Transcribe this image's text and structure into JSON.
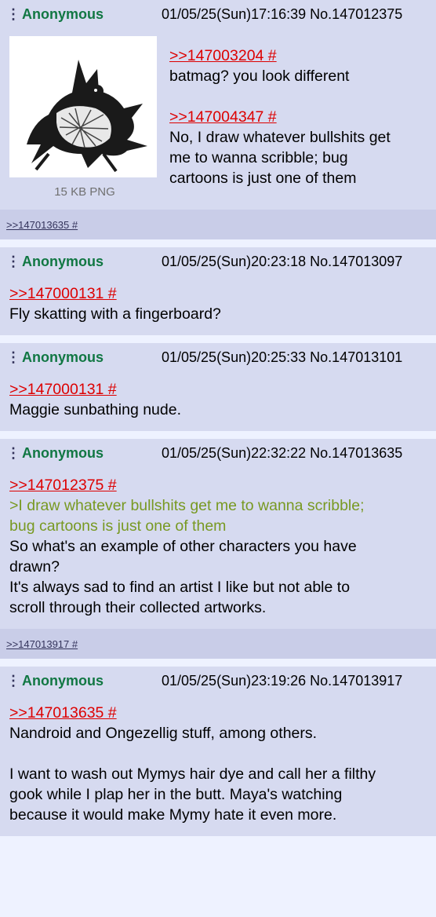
{
  "posts": [
    {
      "name": "Anonymous",
      "date": "01/05/25(Sun)17:16:39",
      "number": "No.147012375",
      "file_info": "15 KB PNG",
      "quote1": ">>147003204 #",
      "line1": "batmag? you look different",
      "quote2": ">>147004347 #",
      "line2a": "No, I draw whatever bullshits get",
      "line2b": "me to wanna scribble; bug",
      "line2c": "cartoons is just one of them",
      "backlink": ">>147013635 #"
    },
    {
      "name": "Anonymous",
      "date": "01/05/25(Sun)20:23:18",
      "number": "No.147013097",
      "quote1": ">>147000131 #",
      "line1": "Fly skatting with a fingerboard?"
    },
    {
      "name": "Anonymous",
      "date": "01/05/25(Sun)20:25:33",
      "number": "No.147013101",
      "quote1": ">>147000131 #",
      "line1": "Maggie sunbathing nude."
    },
    {
      "name": "Anonymous",
      "date": "01/05/25(Sun)22:32:22",
      "number": "No.147013635",
      "quote1": ">>147012375 #",
      "green1": ">I draw whatever bullshits get me to wanna scribble;",
      "green2": "bug cartoons is just one of them",
      "line1": "So what's an example of other characters you have",
      "line2": "drawn?",
      "line3": "It's always sad to find an artist I like but not able to",
      "line4": "scroll through their collected artworks.",
      "backlink": ">>147013917 #"
    },
    {
      "name": "Anonymous",
      "date": "01/05/25(Sun)23:19:26",
      "number": "No.147013917",
      "quote1": ">>147013635 #",
      "line1": "Nandroid and Ongezellig stuff, among others.",
      "line2": "I want to wash out Mymys hair dye and call her a filthy",
      "line3": "gook while I plap her in the butt. Maya's watching",
      "line4": "because it would make Mymy hate it even more."
    }
  ],
  "colors": {
    "name": "#117743",
    "quote": "#dd0000",
    "greentext": "#789922",
    "post_bg": "#d6daf0",
    "page_bg": "#eef2ff"
  },
  "icons": {
    "menu": "vertical-dots-icon"
  }
}
